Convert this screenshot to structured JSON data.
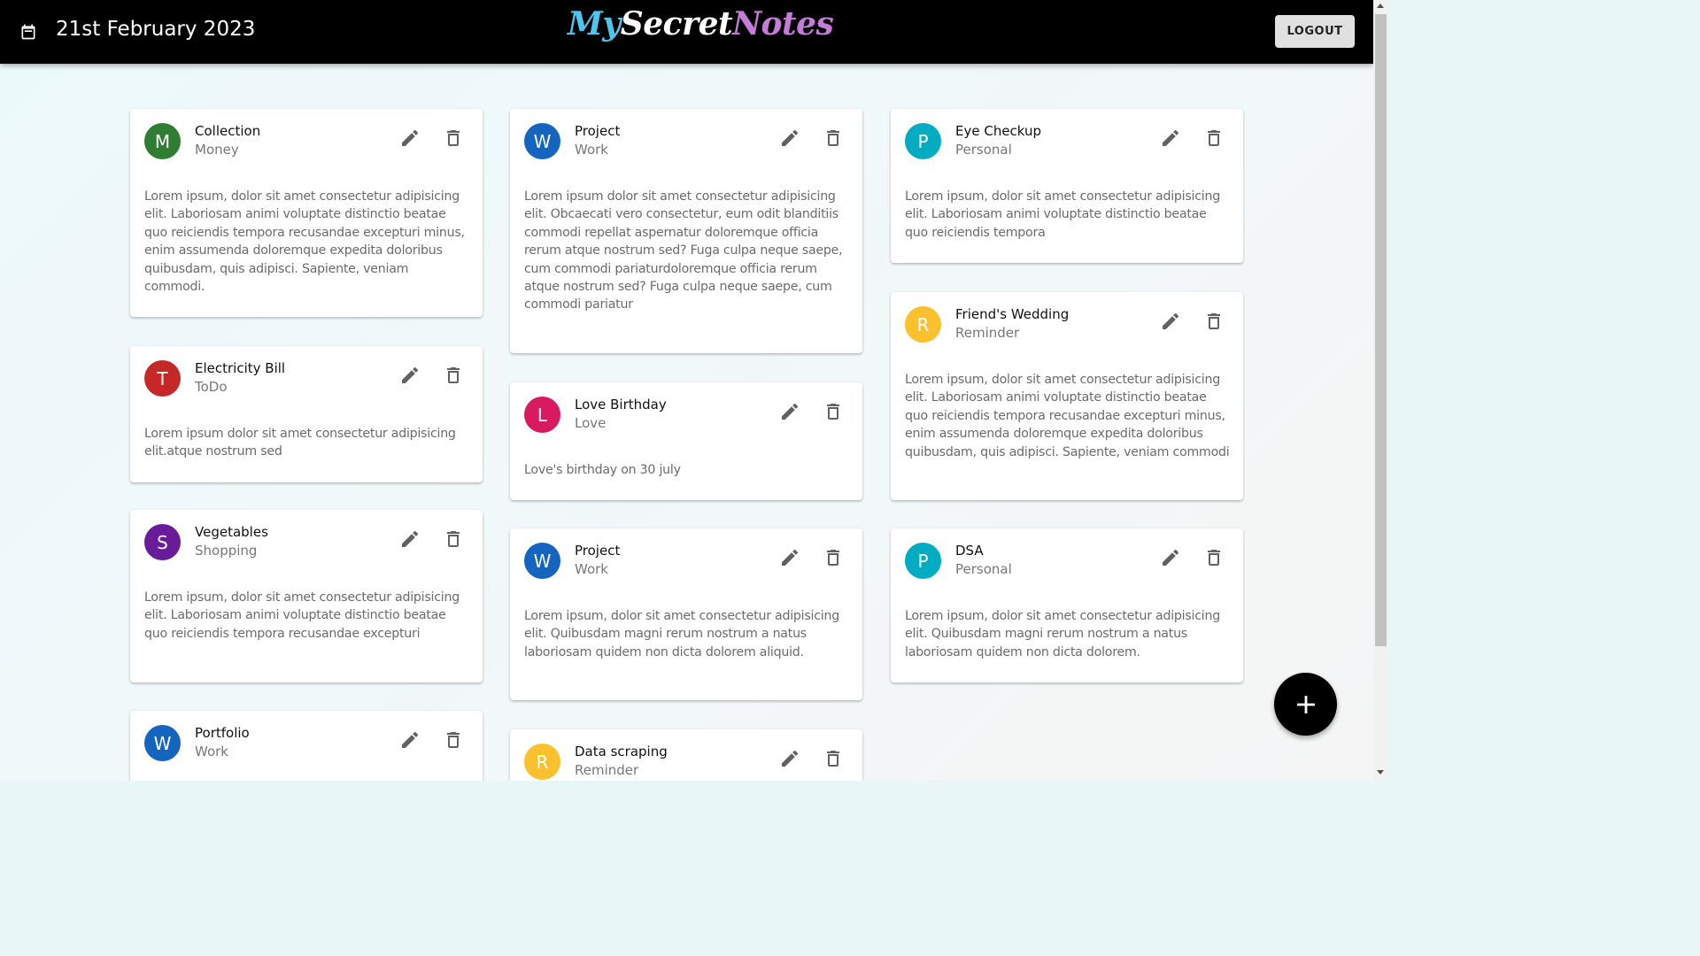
{
  "header": {
    "date": "21st February 2023",
    "brand": {
      "part1": "My",
      "part2": "Secret",
      "part3": "Notes"
    },
    "logout_label": "LOGOUT",
    "calendar_icon": "calendar-icon"
  },
  "colors": {
    "header_bg": "#000000",
    "avatar_green": "#2e7d32",
    "avatar_blue": "#1565c0",
    "avatar_cyan": "#00acc1",
    "avatar_red": "#c62828",
    "avatar_pink": "#d81b60",
    "avatar_amber": "#fbc02d",
    "avatar_purple": "#6a1b9a"
  },
  "notes": [
    {
      "initial": "M",
      "title": "Collection",
      "category": "Money",
      "body": "Lorem ipsum, dolor sit amet consectetur adipisicing elit. Laboriosam animi voluptate distinctio beatae quo reiciendis tempora recusandae excepturi minus, enim assumenda doloremque expedita doloribus quibusdam, quis adipisci. Sapiente, veniam commodi."
    },
    {
      "initial": "T",
      "title": "Electricity Bill",
      "category": "ToDo",
      "body": "Lorem ipsum dolor sit amet consectetur adipisicing elit.atque nostrum sed"
    },
    {
      "initial": "S",
      "title": "Vegetables",
      "category": "Shopping",
      "body": "Lorem ipsum, dolor sit amet consectetur adipisicing elit. Laboriosam animi voluptate distinctio beatae quo reiciendis tempora recusandae excepturi"
    },
    {
      "initial": "W",
      "title": "Portfolio",
      "category": "Work",
      "body": ""
    },
    {
      "initial": "W",
      "title": "Project",
      "category": "Work",
      "body": "Lorem ipsum dolor sit amet consectetur adipisicing elit. Obcaecati vero consectetur, eum odit blanditiis commodi repellat aspernatur doloremque officia rerum atque nostrum sed? Fuga culpa neque saepe, cum commodi pariaturdoloremque officia rerum atque nostrum sed? Fuga culpa neque saepe, cum commodi pariatur"
    },
    {
      "initial": "L",
      "title": "Love Birthday",
      "category": "Love",
      "body": "Love's birthday on 30 july"
    },
    {
      "initial": "W",
      "title": "Project",
      "category": "Work",
      "body": "Lorem ipsum, dolor sit amet consectetur adipisicing elit. Quibusdam magni rerum nostrum a natus laboriosam quidem non dicta dolorem aliquid."
    },
    {
      "initial": "R",
      "title": "Data scraping",
      "category": "Reminder",
      "body": ""
    },
    {
      "initial": "P",
      "title": "Eye Checkup",
      "category": "Personal",
      "body": "Lorem ipsum, dolor sit amet consectetur adipisicing elit. Laboriosam animi voluptate distinctio beatae quo reiciendis tempora"
    },
    {
      "initial": "R",
      "title": "Friend's Wedding",
      "category": "Reminder",
      "body": "Lorem ipsum, dolor sit amet consectetur adipisicing elit. Laboriosam animi voluptate distinctio beatae quo reiciendis tempora recusandae excepturi minus, enim assumenda doloremque expedita doloribus quibusdam, quis adipisci. Sapiente, veniam commodi"
    },
    {
      "initial": "P",
      "title": "DSA",
      "category": "Personal",
      "body": "Lorem ipsum, dolor sit amet consectetur adipisicing elit. Quibusdam magni rerum nostrum a natus laboriosam quidem non dicta dolorem."
    }
  ],
  "icons": {
    "edit": "pencil-icon",
    "delete": "trash-icon",
    "add": "plus-icon"
  }
}
